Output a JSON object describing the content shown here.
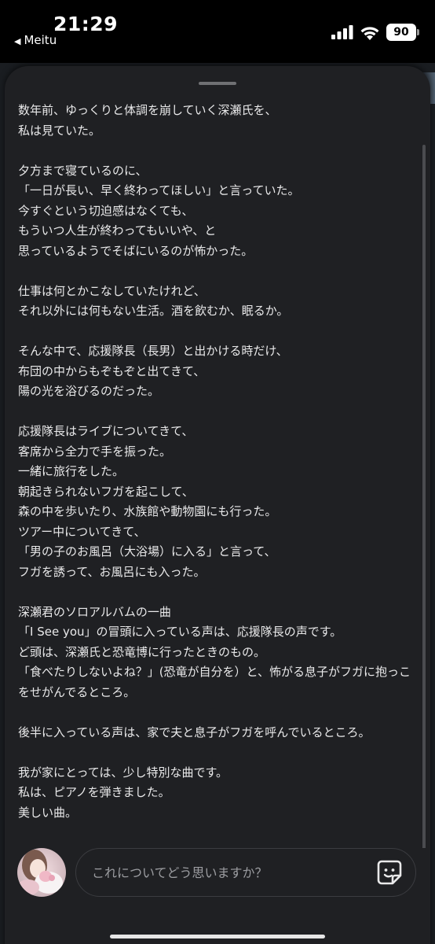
{
  "status_bar": {
    "time": "21:29",
    "back_app": "Meitu",
    "battery": "90",
    "icons": [
      "signal-icon",
      "wifi-icon",
      "battery-icon"
    ]
  },
  "post": {
    "text": "数年前、ゆっくりと体調を崩していく深瀬氏を、\n私は見ていた。\n\n夕方まで寝ているのに、\n「一日が長い、早く終わってほしい」と言っていた。\n今すぐという切迫感はなくても、\nもういつ人生が終わってもいいや、と\n思っているようでそばにいるのが怖かった。\n\n仕事は何とかこなしていたけれど、\nそれ以外には何もない生活。酒を飲むか、眠るか。\n\nそんな中で、応援隊長（長男）と出かける時だけ、\n布団の中からもぞもぞと出てきて、\n陽の光を浴びるのだった。\n\n応援隊長はライブについてきて、\n客席から全力で手を振った。\n一緒に旅行をした。\n朝起きられないフガを起こして、\n森の中を歩いたり、水族館や動物園にも行った。\nツアー中についてきて、\n「男の子のお風呂（大浴場）に入る」と言って、\nフガを誘って、お風呂にも入った。\n\n深瀬君のソロアルバムの一曲\n「I See you」の冒頭に入っている声は、応援隊長の声です。\nど頭は、深瀬氏と恐竜博に行ったときのもの。\n「食べたりしないよね？」(恐竜が自分を）と、怖がる息子がフガに抱っこをせがんでるところ。\n\n後半に入っている声は、家で夫と息子がフガを呼んでいるところ。\n\n我が家にとっては、少し特別な曲です。\n私は、ピアノを弾きました。\n美しい曲。"
  },
  "comment": {
    "placeholder": "これについてどう思いますか？"
  },
  "colors": {
    "sheet_bg": "#1f2023",
    "text": "#e9e9ea",
    "placeholder": "#9c9da1"
  }
}
